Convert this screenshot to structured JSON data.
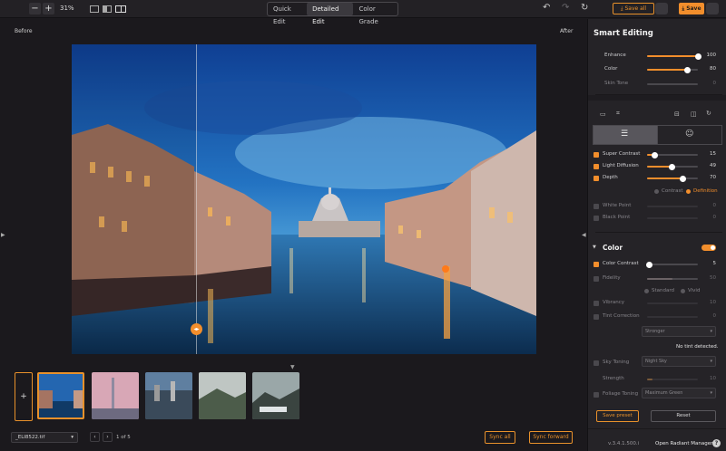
{
  "toolbar": {
    "zoom_out": "−",
    "zoom_in": "+",
    "zoom_level": "31%",
    "tabs": [
      "Quick Edit",
      "Detailed Edit",
      "Color Grade"
    ],
    "save_all": "Save all",
    "save": "Save"
  },
  "canvas": {
    "before_label": "Before",
    "after_label": "After",
    "split_fraction": 0.268
  },
  "filmstrip": {
    "add_label": "+",
    "file_name": "_ELI8522.tif",
    "page_prev": "‹",
    "page_next": "›",
    "page_text": "1 of 5",
    "sync_all": "Sync all",
    "sync_forward": "Sync forward"
  },
  "panel": {
    "title": "Smart Editing",
    "smart": [
      {
        "label": "Enhance",
        "value": "100",
        "level": 1.0,
        "enabled": true
      },
      {
        "label": "Color",
        "value": "80",
        "level": 0.8,
        "enabled": true
      },
      {
        "label": "Skin Tone",
        "value": "0",
        "level": 0.0,
        "enabled": false
      }
    ],
    "tone": [
      {
        "label": "Super Contrast",
        "value": "15",
        "level": 0.15,
        "checked": true
      },
      {
        "label": "Light Diffusion",
        "value": "49",
        "level": 0.49,
        "checked": true
      },
      {
        "label": "Depth",
        "value": "70",
        "level": 0.7,
        "checked": true
      }
    ],
    "depth_modes": {
      "contrast": "Contrast",
      "definition": "Definition",
      "selected": "Definition"
    },
    "points": [
      {
        "label": "White Point",
        "value": "0",
        "checked": false
      },
      {
        "label": "Black Point",
        "value": "0",
        "checked": false
      }
    ],
    "color_section": {
      "title": "Color",
      "enabled": true,
      "color_contrast": {
        "label": "Color Contrast",
        "value": "5",
        "level": 0.05,
        "checked": true
      },
      "fidelity": {
        "label": "Fidelity",
        "value": "50",
        "level": 0.5,
        "checked": false
      },
      "fidelity_modes": {
        "standard": "Standard",
        "vivid": "Vivid"
      },
      "vibrancy": {
        "label": "Vibrancy",
        "value": "10",
        "checked": false
      },
      "tint": {
        "label": "Tint Correction",
        "value": "0",
        "checked": false
      },
      "tint_select": "Stronger",
      "tint_status": "No tint detected.",
      "sky_toning": {
        "label": "Sky Toning",
        "select": "Night Sky",
        "checked": false
      },
      "strength": {
        "label": "Strength",
        "value": "10",
        "level": 0.1
      },
      "foliage": {
        "label": "Foliage Toning",
        "select": "Maximum Green",
        "checked": false
      }
    },
    "save_preset": "Save preset",
    "reset": "Reset",
    "version": "v.3.4.1.500.i",
    "manager": "Open Radiant Manager",
    "help": "?"
  },
  "colors": {
    "accent": "#f28e2c",
    "panel": "#252327",
    "background": "#1b191d"
  }
}
